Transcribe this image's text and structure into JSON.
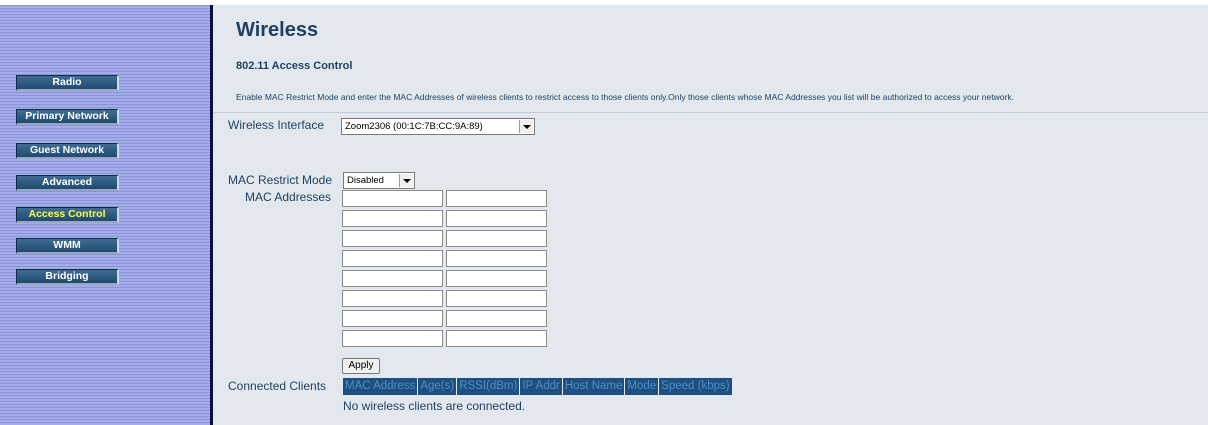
{
  "sidebar": {
    "items": [
      {
        "label": "Radio",
        "active": false
      },
      {
        "label": "Primary Network",
        "active": false
      },
      {
        "label": "Guest Network",
        "active": false
      },
      {
        "label": "Advanced",
        "active": false
      },
      {
        "label": "Access Control",
        "active": true
      },
      {
        "label": "WMM",
        "active": false
      },
      {
        "label": "Bridging",
        "active": false
      }
    ]
  },
  "page": {
    "title": "Wireless",
    "section_title": "802.11 Access Control",
    "description": "Enable MAC Restrict Mode and enter the MAC Addresses of wireless clients to restrict access to those clients only.Only those clients whose MAC Addresses you list will be authorized to access your network."
  },
  "form": {
    "interface_label": "Wireless Interface",
    "interface_value": "Zoom2306 (00:1C:7B:CC:9A:89)",
    "restrict_label": "MAC Restrict Mode",
    "restrict_value": "Disabled",
    "mac_label": "MAC Addresses",
    "mac_values": [
      "",
      "",
      "",
      "",
      "",
      "",
      "",
      "",
      "",
      "",
      "",
      "",
      "",
      "",
      "",
      ""
    ],
    "apply_label": "Apply"
  },
  "clients": {
    "label": "Connected Clients",
    "columns": [
      "MAC Address",
      "Age(s)",
      "RSSI(dBm)",
      "IP Addr",
      "Host Name",
      "Mode",
      "Speed (kbps)"
    ],
    "empty_text": "No wireless clients are connected."
  },
  "colors": {
    "sidebar_bg": "#a4acec",
    "nav_button": "#2e5a80",
    "active_nav_text": "#ffff33",
    "heading_text": "#1e3f5f",
    "table_header_bg": "#1e4f80"
  }
}
